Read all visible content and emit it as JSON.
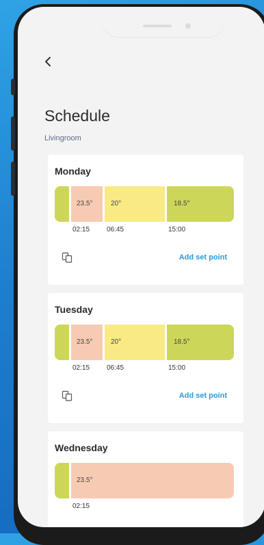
{
  "page": {
    "back_icon": "chevron-left-icon",
    "title": "Schedule",
    "room": "Livingroom"
  },
  "colors": {
    "green": "#ccd75a",
    "peach": "#f7cbb3",
    "yellow": "#f9ea85",
    "link": "#2a9bd6"
  },
  "days": [
    {
      "name": "Monday",
      "segments": [
        {
          "label": "",
          "color": "green"
        },
        {
          "label": "23.5°",
          "color": "peach"
        },
        {
          "label": "20°",
          "color": "yellow"
        },
        {
          "label": "18.5°",
          "color": "green"
        }
      ],
      "times": [
        "02:15",
        "06:45",
        "15:00"
      ],
      "copy_icon": "copy-icon",
      "add_label": "Add set point"
    },
    {
      "name": "Tuesday",
      "segments": [
        {
          "label": "",
          "color": "green"
        },
        {
          "label": "23.5°",
          "color": "peach"
        },
        {
          "label": "20°",
          "color": "yellow"
        },
        {
          "label": "18.5°",
          "color": "green"
        }
      ],
      "times": [
        "02:15",
        "06:45",
        "15:00"
      ],
      "copy_icon": "copy-icon",
      "add_label": "Add set point"
    },
    {
      "name": "Wednesday",
      "segments": [
        {
          "label": "",
          "color": "green"
        },
        {
          "label": "23.5°",
          "color": "peach"
        }
      ],
      "times": [
        "02:15"
      ]
    }
  ]
}
